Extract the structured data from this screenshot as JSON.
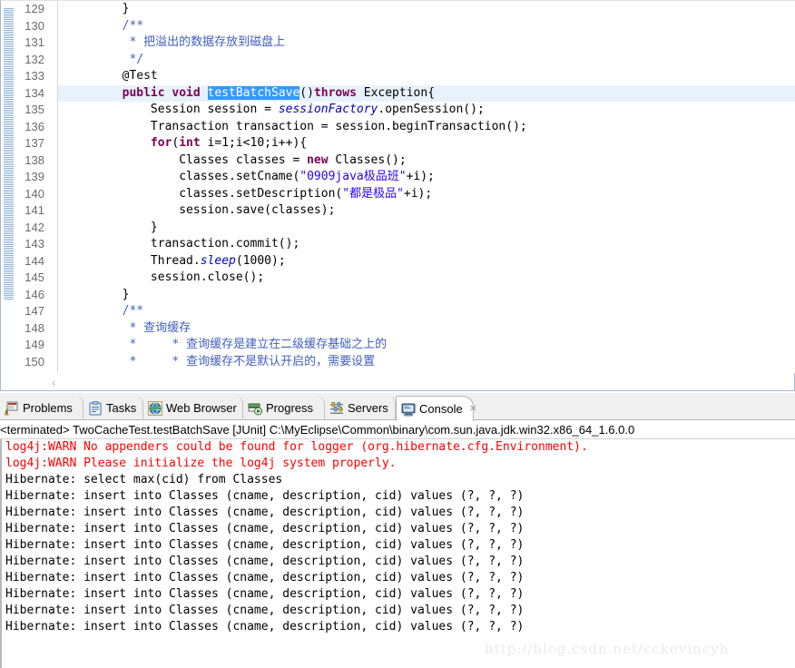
{
  "editor": {
    "first_line_number": 129,
    "highlighted_line": 134,
    "selection_text": "testBatchSave",
    "folding_lines": [
      130,
      133,
      147
    ],
    "change_bar_lines": [
      130,
      146
    ],
    "hscroll_chevron": "‹",
    "lines": [
      {
        "n": 129,
        "fold": false,
        "highlight": false,
        "tokens": [
          {
            "t": "        }",
            "c": "plain"
          }
        ]
      },
      {
        "n": 130,
        "fold": true,
        "highlight": false,
        "tokens": [
          {
            "t": "        /**",
            "c": "cmt"
          }
        ]
      },
      {
        "n": 131,
        "fold": false,
        "highlight": false,
        "tokens": [
          {
            "t": "         * ",
            "c": "cmt"
          },
          {
            "t": "把溢出的数据存放到磁盘上",
            "c": "cmt"
          }
        ]
      },
      {
        "n": 132,
        "fold": false,
        "highlight": false,
        "tokens": [
          {
            "t": "         */",
            "c": "cmt"
          }
        ]
      },
      {
        "n": 133,
        "fold": true,
        "highlight": false,
        "tokens": [
          {
            "t": "        @Test",
            "c": "plain"
          }
        ]
      },
      {
        "n": 134,
        "fold": false,
        "highlight": true,
        "tokens": [
          {
            "t": "        public void ",
            "c": "kw"
          },
          {
            "t": "testBatchSave",
            "c": "sel"
          },
          {
            "t": "()",
            "c": "plain"
          },
          {
            "t": "throws",
            "c": "kw"
          },
          {
            "t": " Exception{",
            "c": "plain"
          }
        ]
      },
      {
        "n": 135,
        "fold": false,
        "highlight": false,
        "tokens": [
          {
            "t": "            Session session = ",
            "c": "plain"
          },
          {
            "t": "sessionFactory",
            "c": "fld"
          },
          {
            "t": ".openSession();",
            "c": "plain"
          }
        ]
      },
      {
        "n": 136,
        "fold": false,
        "highlight": false,
        "tokens": [
          {
            "t": "            Transaction transaction = session.beginTransaction();",
            "c": "plain"
          }
        ]
      },
      {
        "n": 137,
        "fold": false,
        "highlight": false,
        "tokens": [
          {
            "t": "            for",
            "c": "kw"
          },
          {
            "t": "(",
            "c": "plain"
          },
          {
            "t": "int",
            "c": "kw"
          },
          {
            "t": " i=1;i<10;i++){",
            "c": "plain"
          }
        ]
      },
      {
        "n": 138,
        "fold": false,
        "highlight": false,
        "tokens": [
          {
            "t": "                Classes classes = ",
            "c": "plain"
          },
          {
            "t": "new",
            "c": "kw"
          },
          {
            "t": " Classes();",
            "c": "plain"
          }
        ]
      },
      {
        "n": 139,
        "fold": false,
        "highlight": false,
        "tokens": [
          {
            "t": "                classes.setCname(",
            "c": "plain"
          },
          {
            "t": "\"0909java极品班\"",
            "c": "str"
          },
          {
            "t": "+i);",
            "c": "plain"
          }
        ]
      },
      {
        "n": 140,
        "fold": false,
        "highlight": false,
        "tokens": [
          {
            "t": "                classes.setDescription(",
            "c": "plain"
          },
          {
            "t": "\"都是极品\"",
            "c": "str"
          },
          {
            "t": "+i);",
            "c": "plain"
          }
        ]
      },
      {
        "n": 141,
        "fold": false,
        "highlight": false,
        "tokens": [
          {
            "t": "                session.save(classes);",
            "c": "plain"
          }
        ]
      },
      {
        "n": 142,
        "fold": false,
        "highlight": false,
        "tokens": [
          {
            "t": "            }",
            "c": "plain"
          }
        ]
      },
      {
        "n": 143,
        "fold": false,
        "highlight": false,
        "tokens": [
          {
            "t": "            transaction.commit();",
            "c": "plain"
          }
        ]
      },
      {
        "n": 144,
        "fold": false,
        "highlight": false,
        "tokens": [
          {
            "t": "            Thread.",
            "c": "plain"
          },
          {
            "t": "sleep",
            "c": "fld"
          },
          {
            "t": "(1000);",
            "c": "plain"
          }
        ]
      },
      {
        "n": 145,
        "fold": false,
        "highlight": false,
        "tokens": [
          {
            "t": "            session.close();",
            "c": "plain"
          }
        ]
      },
      {
        "n": 146,
        "fold": false,
        "highlight": false,
        "tokens": [
          {
            "t": "        }",
            "c": "plain"
          }
        ]
      },
      {
        "n": 147,
        "fold": true,
        "highlight": false,
        "tokens": [
          {
            "t": "        /**",
            "c": "cmt"
          }
        ]
      },
      {
        "n": 148,
        "fold": false,
        "highlight": false,
        "tokens": [
          {
            "t": "         * ",
            "c": "cmt"
          },
          {
            "t": "查询缓存",
            "c": "cmt"
          }
        ]
      },
      {
        "n": 149,
        "fold": false,
        "highlight": false,
        "tokens": [
          {
            "t": "         *     * ",
            "c": "cmt"
          },
          {
            "t": "查询缓存是建立在二级缓存基础之上的",
            "c": "cmt"
          }
        ]
      },
      {
        "n": 150,
        "fold": false,
        "highlight": false,
        "tokens": [
          {
            "t": "         *     * ",
            "c": "cmt"
          },
          {
            "t": "查询缓存不是默认开启的，需要设置",
            "c": "cmt"
          }
        ]
      }
    ]
  },
  "view_tabs": [
    {
      "label": "Problems",
      "icon": "problems-icon",
      "active": false,
      "closable": false
    },
    {
      "label": "Tasks",
      "icon": "tasks-icon",
      "active": false,
      "closable": false
    },
    {
      "label": "Web Browser",
      "icon": "web-browser-icon",
      "active": false,
      "closable": false
    },
    {
      "label": "Progress",
      "icon": "progress-icon",
      "active": false,
      "closable": false
    },
    {
      "label": "Servers",
      "icon": "servers-icon",
      "active": false,
      "closable": false
    },
    {
      "label": "Console",
      "icon": "console-icon",
      "active": true,
      "closable": true,
      "close_glyph": "⨯"
    }
  ],
  "console": {
    "header": "<terminated> TwoCacheTest.testBatchSave [JUnit] C:\\MyEclipse\\Common\\binary\\com.sun.java.jdk.win32.x86_64_1.6.0.0",
    "lines": [
      {
        "text": "log4j:WARN No appenders could be found for logger (org.hibernate.cfg.Environment).",
        "error": true
      },
      {
        "text": "log4j:WARN Please initialize the log4j system properly.",
        "error": true
      },
      {
        "text": "Hibernate: select max(cid) from Classes",
        "error": false
      },
      {
        "text": "Hibernate: insert into Classes (cname, description, cid) values (?, ?, ?)",
        "error": false
      },
      {
        "text": "Hibernate: insert into Classes (cname, description, cid) values (?, ?, ?)",
        "error": false
      },
      {
        "text": "Hibernate: insert into Classes (cname, description, cid) values (?, ?, ?)",
        "error": false
      },
      {
        "text": "Hibernate: insert into Classes (cname, description, cid) values (?, ?, ?)",
        "error": false
      },
      {
        "text": "Hibernate: insert into Classes (cname, description, cid) values (?, ?, ?)",
        "error": false
      },
      {
        "text": "Hibernate: insert into Classes (cname, description, cid) values (?, ?, ?)",
        "error": false
      },
      {
        "text": "Hibernate: insert into Classes (cname, description, cid) values (?, ?, ?)",
        "error": false
      },
      {
        "text": "Hibernate: insert into Classes (cname, description, cid) values (?, ?, ?)",
        "error": false
      },
      {
        "text": "Hibernate: insert into Classes (cname, description, cid) values (?, ?, ?)",
        "error": false
      }
    ]
  },
  "watermark": {
    "text": "http://blog.csdn.net/cckevincyh"
  },
  "colors": {
    "keyword": "#7f0055",
    "string": "#2a00ff",
    "comment": "#3f5fbf",
    "field": "#0000c0",
    "selection": "#3399ff",
    "current_line": "#e8f2fe",
    "console_error": "#ff0000"
  }
}
